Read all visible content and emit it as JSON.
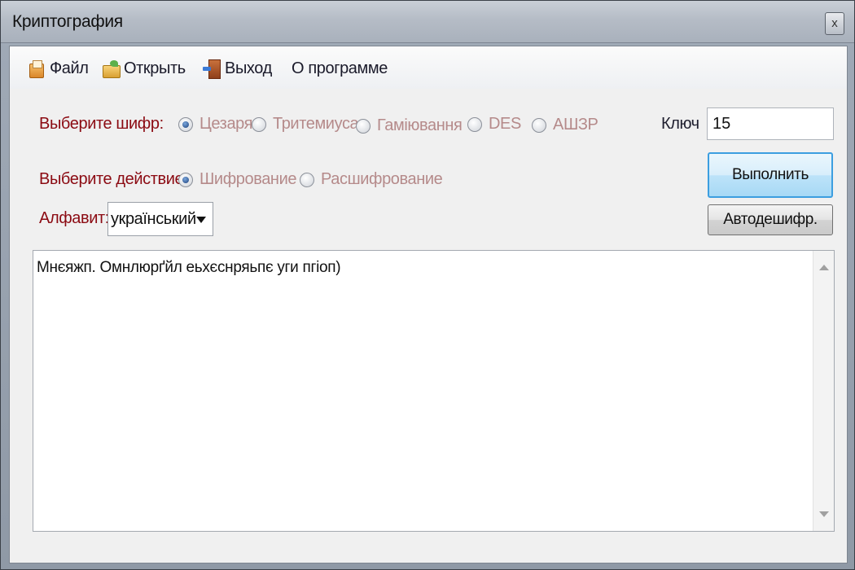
{
  "window": {
    "title": "Криптография",
    "close_glyph": "x"
  },
  "menu": {
    "file": "Файл",
    "open": "Открыть",
    "exit": "Выход",
    "about": "О программе"
  },
  "cipher": {
    "label": "Выберите шифр:",
    "options": [
      "Цезаря",
      "Тритемиуса",
      "Гаміювання",
      "DES",
      "АШЗР"
    ],
    "selected": "Цезаря"
  },
  "key": {
    "label": "Ключ",
    "value": "15"
  },
  "action": {
    "label": "Выберите действие:",
    "options": [
      "Шифрование",
      "Расшифрование"
    ],
    "selected": "Шифрование"
  },
  "alphabet": {
    "label": "Алфавит:",
    "value": "український"
  },
  "buttons": {
    "execute": "Выполнить",
    "autodecrypt": "Автодешифр."
  },
  "text_area": {
    "content": "Мнєяжп. Омнлюрґйл еьхєснряьпє уги пгіоп)"
  },
  "colors": {
    "label_accent": "#8b0a12",
    "radio_text": "#b58a8a",
    "primary_button_border": "#3c9ee0"
  }
}
